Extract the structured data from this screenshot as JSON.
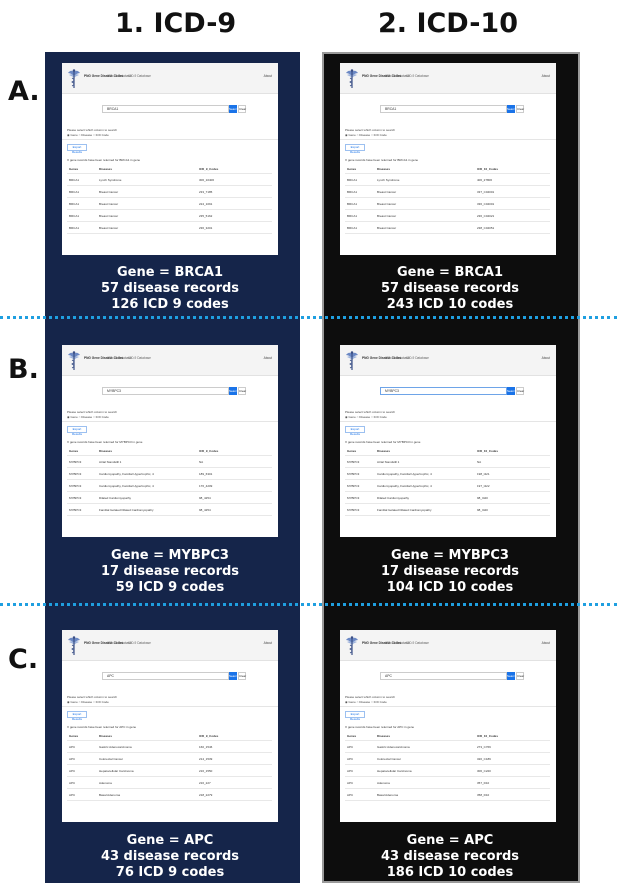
{
  "headers": {
    "icd9": "1. ICD-9",
    "icd10": "2. ICD-10"
  },
  "rows": [
    {
      "label": "A.",
      "icd9": {
        "brand": "PNG Gene Disease Codes",
        "link1": "ICD-10 Database",
        "link2": "ICD-9 Database",
        "about": "About",
        "query": "BRCA1",
        "search_btn": "Search",
        "clear_btn": "Clear",
        "hint": "Please select which column to search",
        "radios": "◉ Gene  ○ Disease  ○ ICD Code",
        "export": "Export Results",
        "returned": "X gene records have been returned for BRCA1 in gene",
        "cols": [
          "Genes",
          "Diseases",
          "ICD_9_Codes"
        ],
        "table": [
          [
            "BRCA1",
            "Lynch Syndrome",
            "306_10406"
          ],
          [
            "BRCA1",
            "Breast Cancer",
            "233_7185"
          ],
          [
            "BRCA1",
            "Breast Cancer",
            "224_1091"
          ],
          [
            "BRCA1",
            "Breast Cancer",
            "235_5162"
          ],
          [
            "BRCA1",
            "Breast Cancer",
            "236_3201"
          ]
        ],
        "cap1": "Gene = BRCA1",
        "cap2": "57 disease records",
        "cap3": "126 ICD 9 codes"
      },
      "icd10": {
        "brand": "PNG Gene Disease Codes",
        "link1": "ICD-10 Database",
        "link2": "ICD-9 Database",
        "about": "About",
        "query": "BRCA1",
        "search_btn": "Search",
        "clear_btn": "Clear",
        "hint": "Please select which column to search",
        "radios": "◉ Gene  ○ Disease  ○ ICD Code",
        "export": "Export Results",
        "returned": "X gene records have been returned for BRCA1 in gene",
        "cols": [
          "Genes",
          "Diseases",
          "ICD_10_Codes"
        ],
        "table": [
          [
            "BRCA1",
            "Lynch Syndrome",
            "406_27806"
          ],
          [
            "BRCA1",
            "Breast Cancer",
            "337_C04001"
          ],
          [
            "BRCA1",
            "Breast Cancer",
            "336_C04001"
          ],
          [
            "BRCA1",
            "Breast Cancer",
            "236_C04021"
          ],
          [
            "BRCA1",
            "Breast Cancer",
            "238_C04051"
          ]
        ],
        "cap1": "Gene = BRCA1",
        "cap2": "57 disease records",
        "cap3": "243 ICD 10 codes"
      }
    },
    {
      "label": "B.",
      "icd9": {
        "brand": "PNG Gene Disease Codes",
        "link1": "ICD-10 Database",
        "link2": "ICD-9 Database",
        "about": "About",
        "query": "MYBPC3",
        "search_btn": "Search",
        "clear_btn": "Clear",
        "hint": "Please select which column to search",
        "radios": "◉ Gene  ○ Disease  ○ ICD Code",
        "export": "Export Results",
        "returned": "X gene records have been returned for MYBPC3 in gene",
        "cols": [
          "Genes",
          "Diseases",
          "ICD_9_Codes"
        ],
        "table": [
          [
            "MYBPC3",
            "Atrial Standstill 1",
            "NA"
          ],
          [
            "MYBPC3",
            "Cardiomyopathy, Familial Hypertrophic, 4",
            "189_6301"
          ],
          [
            "MYBPC3",
            "Cardiomyopathy, Familial Hypertrophic, 4",
            "176_4209"
          ],
          [
            "MYBPC3",
            "Dilated Cardiomyopathy",
            "98_4254"
          ],
          [
            "MYBPC3",
            "Familial Isolated Dilated Cardiomyopathy",
            "98_4254"
          ]
        ],
        "cap1": "Gene = MYBPC3",
        "cap2": "17 disease records",
        "cap3": "59 ICD 9 codes"
      },
      "icd10": {
        "brand": "PNG Gene Disease Codes",
        "link1": "ICD-10 Database",
        "link2": "ICD-9 Database",
        "about": "About",
        "query": "MYBPC3",
        "search_btn": "Search",
        "clear_btn": "Clear",
        "hint": "Please select which column to search",
        "radios": "◉ Gene  ○ Disease  ○ ICD Code",
        "export": "Export Results",
        "returned": "X gene records have been returned for MYBPC3 in gene",
        "cols": [
          "Genes",
          "Diseases",
          "ICD_10_Codes"
        ],
        "table": [
          [
            "MYBPC3",
            "Atrial Standstill 1",
            "NA"
          ],
          [
            "MYBPC3",
            "Cardiomyopathy, Familial Hypertrophic, 4",
            "198_I421"
          ],
          [
            "MYBPC3",
            "Cardiomyopathy, Familial Hypertrophic, 4",
            "197_I422"
          ],
          [
            "MYBPC3",
            "Dilated Cardiomyopathy",
            "98_I420"
          ],
          [
            "MYBPC3",
            "Familial Isolated Dilated Cardiomyopathy",
            "98_I420"
          ]
        ],
        "cap1": "Gene = MYBPC3",
        "cap2": "17 disease records",
        "cap3": "104 ICD 10 codes"
      }
    },
    {
      "label": "C.",
      "icd9": {
        "brand": "PNG Gene Disease Codes",
        "link1": "ICD-10 Database",
        "link2": "ICD-9 Database",
        "about": "About",
        "query": "APC",
        "search_btn": "Search",
        "clear_btn": "Clear",
        "hint": "Please select which column to search",
        "radios": "◉ Gene  ○ Disease  ○ ICD Code",
        "export": "Export Results",
        "returned": "X gene records have been returned for APC in gene",
        "cols": [
          "Genes",
          "Diseases",
          "ICD_9_Codes"
        ],
        "table": [
          [
            "APC",
            "Gastric Adenocarcinoma",
            "160_1546"
          ],
          [
            "APC",
            "Colorectal Cancer",
            "214_1539"
          ],
          [
            "APC",
            "Hepatocellular Carcinoma",
            "216_1550"
          ],
          [
            "APC",
            "Adenoma",
            "216_227"
          ],
          [
            "APC",
            "Basal Adenoma",
            "218_2279"
          ]
        ],
        "cap1": "Gene = APC",
        "cap2": "43 disease records",
        "cap3": "76 ICD 9 codes"
      },
      "icd10": {
        "brand": "PNG Gene Disease Codes",
        "link1": "ICD-10 Database",
        "link2": "ICD-9 Database",
        "about": "About",
        "query": "APC",
        "search_btn": "Search",
        "clear_btn": "Clear",
        "hint": "Please select which column to search",
        "radios": "◉ Gene  ○ Disease  ○ ICD Code",
        "export": "Export Results",
        "returned": "X gene records have been returned for APC in gene",
        "cols": [
          "Genes",
          "Diseases",
          "ICD_10_Codes"
        ],
        "table": [
          [
            "APC",
            "Gastric Adenocarcinoma",
            "273_C769"
          ],
          [
            "APC",
            "Colorectal Cancer",
            "320_C189"
          ],
          [
            "APC",
            "Hepatocellular Carcinoma",
            "306_C220"
          ],
          [
            "APC",
            "Adenoma",
            "357_D10"
          ],
          [
            "APC",
            "Basal Adenoma",
            "358_D10"
          ]
        ],
        "cap1": "Gene = APC",
        "cap2": "43 disease records",
        "cap3": "186 ICD 10 codes"
      }
    }
  ]
}
